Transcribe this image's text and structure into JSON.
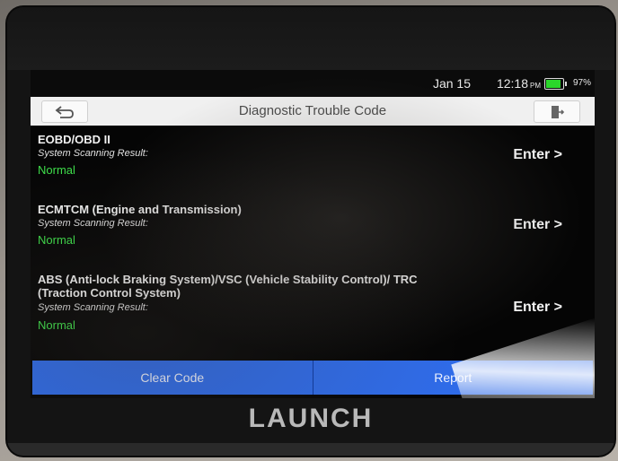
{
  "status_bar": {
    "date": "Jan 15",
    "time": "12:18",
    "ampm": "PM",
    "battery_percent": "97%",
    "battery_level": 0.97,
    "battery_color": "#2bd62b"
  },
  "title_bar": {
    "title": "Diagnostic Trouble Code",
    "back_icon": "back-arrow-icon",
    "exit_icon": "exit-icon"
  },
  "systems": [
    {
      "name": "EOBD/OBD II",
      "result_label": "System Scanning Result:",
      "status": "Normal",
      "enter_label": "Enter >"
    },
    {
      "name": "ECMTCM (Engine and Transmission)",
      "result_label": "System Scanning Result:",
      "status": "Normal",
      "enter_label": "Enter >"
    },
    {
      "name": "ABS (Anti-lock Braking System)/VSC (Vehicle Stability Control)/ TRC (Traction Control System)",
      "result_label": "System Scanning Result:",
      "status": "Normal",
      "enter_label": "Enter >"
    }
  ],
  "bottom_bar": {
    "clear_code_label": "Clear Code",
    "report_label": "Report"
  },
  "colors": {
    "status_normal": "#3ee04a",
    "button_blue": "#2f6be8"
  },
  "brand": "LAUNCH"
}
